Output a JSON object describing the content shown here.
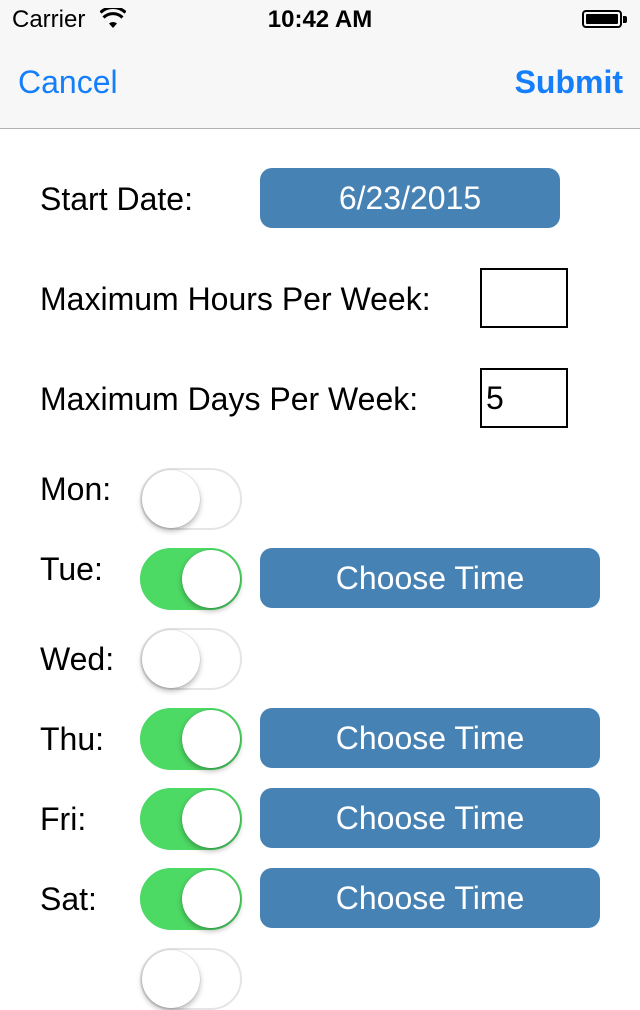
{
  "status_bar": {
    "carrier": "Carrier",
    "time": "10:42 AM"
  },
  "nav": {
    "cancel_label": "Cancel",
    "submit_label": "Submit"
  },
  "form": {
    "start_date_label": "Start Date:",
    "start_date_value": "6/23/2015",
    "max_hours_label": "Maximum Hours Per Week:",
    "max_hours_value": "",
    "max_days_label": "Maximum Days Per Week:",
    "max_days_value": "5"
  },
  "days": [
    {
      "label": "Mon:",
      "enabled": false,
      "button_label": ""
    },
    {
      "label": "Tue:",
      "enabled": true,
      "button_label": "Choose Time"
    },
    {
      "label": "Wed:",
      "enabled": false,
      "button_label": ""
    },
    {
      "label": "Thu:",
      "enabled": true,
      "button_label": "Choose Time"
    },
    {
      "label": "Fri:",
      "enabled": true,
      "button_label": "Choose Time"
    },
    {
      "label": "Sat:",
      "enabled": true,
      "button_label": "Choose Time"
    },
    {
      "label": "",
      "enabled": false,
      "button_label": ""
    }
  ],
  "colors": {
    "accent": "#147efb",
    "button": "#4682b4",
    "toggle_on": "#4cd964"
  }
}
